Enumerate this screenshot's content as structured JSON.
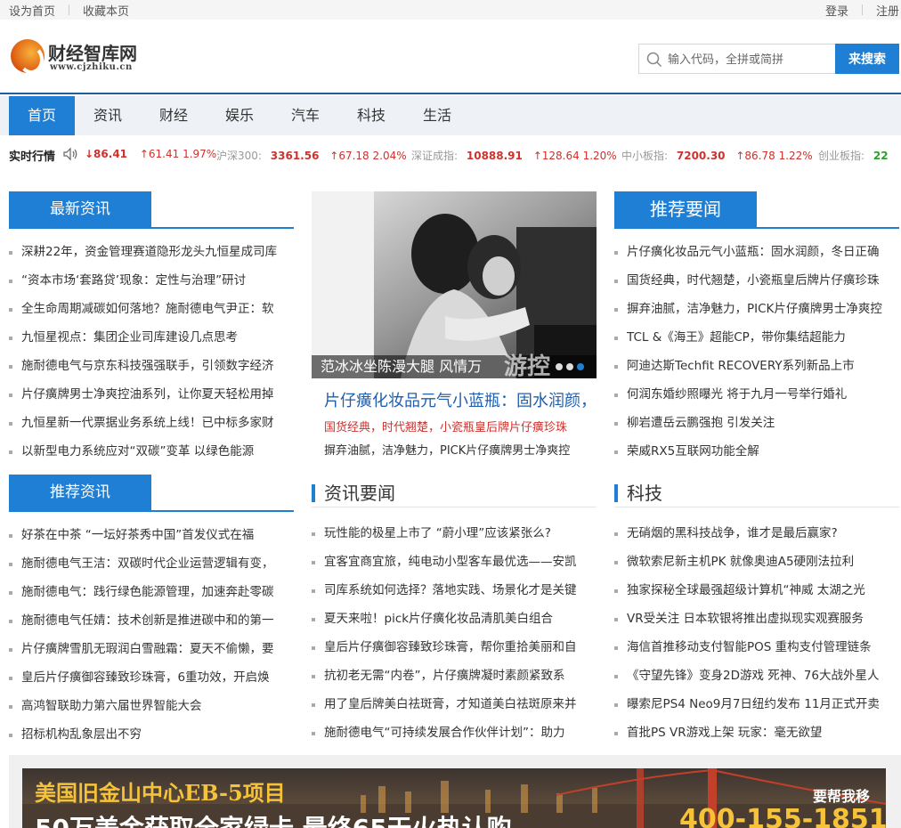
{
  "topbar": {
    "set_home": "设为首页",
    "bookmark": "收藏本页",
    "login": "登录",
    "register": "注册"
  },
  "logo": {
    "name": "财经智库网",
    "url": "www.cjzhiku.cn"
  },
  "search": {
    "placeholder": "输入代码，全拼或简拼",
    "button": "来搜索"
  },
  "nav": [
    "首页",
    "资讯",
    "财经",
    "娱乐",
    "汽车",
    "科技",
    "生活"
  ],
  "ticker": {
    "label": "实时行情",
    "items": [
      {
        "name": "",
        "value": "↓86.41",
        "change": "↑61.41 1.97%"
      },
      {
        "name": "沪深300:",
        "value": "3361.56",
        "change": "↑67.18 2.04%"
      },
      {
        "name": "深证成指:",
        "value": "10888.91",
        "change": "↑128.64 1.20%"
      },
      {
        "name": "中小板指:",
        "value": "7200.30",
        "change": "↑86.78 1.22%"
      },
      {
        "name": "创业板指:",
        "value": "22",
        "change": ""
      }
    ]
  },
  "latest": {
    "title": "最新资讯",
    "items": [
      "深耕22年，资金管理赛道隐形龙头九恒星成司库",
      "“资本市场‘套路贷’现象：定性与治理”研讨",
      "全生命周期减碳如何落地？施耐德电气尹正：软",
      "九恒星视点：集团企业司库建设几点思考",
      "施耐德电气与京东科技强强联手，引领数字经济",
      "片仔癀牌男士净爽控油系列，让你夏天轻松用掉",
      "九恒星新一代票据业务系统上线！已中标多家财",
      "以新型电力系统应对“双碳”变革 以绿色能源"
    ]
  },
  "slider": {
    "caption": "范冰冰坐陈漫大腿 风情万",
    "watermark": "游控"
  },
  "headline": {
    "title": "片仔癀化妆品元气小蓝瓶：固水润颜，",
    "sub1": "国货经典，时代翘楚，小瓷瓶皇后牌片仔癀珍珠",
    "sub2": "摒弃油腻，洁净魅力，PICK片仔癀牌男士净爽控"
  },
  "featured": {
    "title": "推荐要闻",
    "items": [
      "片仔癀化妆品元气小蓝瓶：固水润颜，冬日正确",
      "国货经典，时代翘楚，小瓷瓶皇后牌片仔癀珍珠",
      "摒弃油腻，洁净魅力，PICK片仔癀牌男士净爽控",
      "TCL &《海王》超能CP，带你集结超能力",
      "阿迪达斯Techfit RECOVERY系列新品上市",
      "何润东婚纱照曝光 将于九月一号举行婚礼",
      "柳岩遭岳云鹏强抱 引发关注",
      "荣威RX5互联网功能全解"
    ]
  },
  "recommended": {
    "title": "推荐资讯",
    "items": [
      "好茶在中茶 “一坛好茶秀中国”首发仪式在福",
      "施耐德电气王洁：双碳时代企业运营逻辑有变，",
      "施耐德电气：践行绿色能源管理，加速奔赴零碳",
      "施耐德电气任婧：技术创新是推进碳中和的第一",
      "片仔癀牌雪肌无瑕润白雪融霜：夏天不偷懒，要",
      "皇后片仔癀御容臻致珍珠膏，6重功效，开启焕",
      "高鸿智联助力第六届世界智能大会",
      "招标机构乱象层出不穷"
    ]
  },
  "news": {
    "title": "资讯要闻",
    "items": [
      "玩性能的极星上市了 “蔚小理”应该紧张么?",
      "宜客宜商宜旅，纯电动小型客车最优选——安凯",
      "司库系统如何选择？落地实践、场景化才是关键",
      "夏天来啦！pick片仔癀化妆品清肌美白组合",
      "皇后片仔癀御容臻致珍珠膏，帮你重拾美丽和自",
      "抗初老无需“内卷”，片仔癀牌凝时素颜紧致系",
      "用了皇后牌美白祛斑膏，才知道美白祛斑原来并",
      "施耐德电气“可持续发展合作伙伴计划”：助力"
    ]
  },
  "tech": {
    "title": "科技",
    "items": [
      "无硝烟的黑科技战争，谁才是最后赢家?",
      "微软索尼新主机PK 就像奥迪A5硬刚法拉利",
      "独家探秘全球最强超级计算机“神威 太湖之光",
      "VR受关注 日本软银将推出虚拟现实观赛服务",
      "海信首推移动支付智能POS 重构支付管理链条",
      "《守望先锋》变身2D游戏 死神、76大战外星人",
      "曝索尼PS4 Neo9月7日纽约发布 11月正式开卖",
      "首批PS VR游戏上架 玩家：毫无欲望"
    ]
  },
  "banner": {
    "line1": "美国旧金山中心EB-5项目",
    "line2": "50万美金获取全家绿卡 最终65天火热认购",
    "help": "要帮我移",
    "phone": "400-155-1851"
  },
  "colors": {
    "brand_blue": "#1f7fd5",
    "up_red": "#d0312d",
    "down_green": "#2aa12a"
  }
}
